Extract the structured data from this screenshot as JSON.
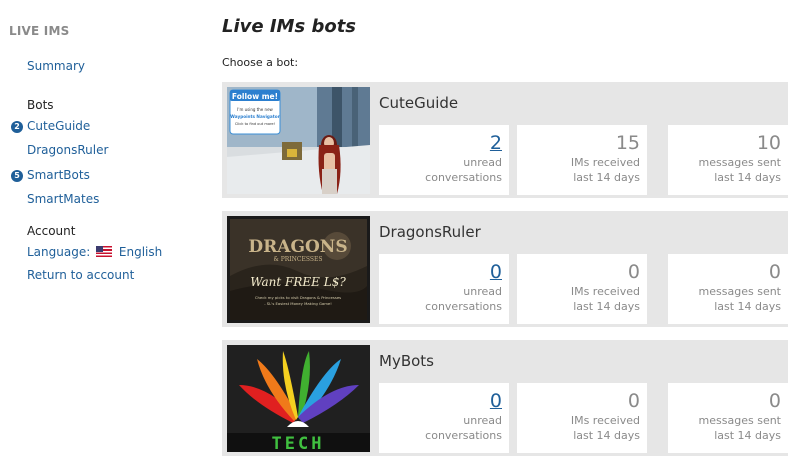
{
  "sidebar": {
    "title": "LIVE IMS",
    "summary_label": "Summary",
    "bots_heading": "Bots",
    "bots": [
      {
        "label": "CuteGuide",
        "badge": "2",
        "active": true
      },
      {
        "label": "DragonsRuler",
        "badge": "",
        "active": false
      },
      {
        "label": "SmartBots",
        "badge": "5",
        "active": true
      },
      {
        "label": "SmartMates",
        "badge": "",
        "active": false
      }
    ],
    "account_heading": "Account",
    "language_label": "Language:",
    "language_value": "English",
    "return_label": "Return to account"
  },
  "main": {
    "title": "Live IMs bots",
    "choose_label": "Choose a bot:",
    "stat_labels": {
      "unread_1": "unread",
      "unread_2": "conversations",
      "received_1": "IMs received",
      "received_2": "last 14 days",
      "sent_1": "messages sent",
      "sent_2": "last 14 days"
    },
    "bots": [
      {
        "name": "CuteGuide",
        "unread": "2",
        "received": "15",
        "sent": "10",
        "thumb_text_1": "Follow me!",
        "thumb_text_2": "I'm using the new",
        "thumb_text_3": "Waypoints Navigator",
        "thumb_text_4": "Click to find out more!"
      },
      {
        "name": "DragonsRuler",
        "unread": "0",
        "received": "0",
        "sent": "0",
        "thumb_text_1": "DRAGONS",
        "thumb_text_2": "& PRINCESSES",
        "thumb_text_3": "Want FREE L$?",
        "thumb_text_4": "Check my picks to visit Dragons & Princesses",
        "thumb_text_5": "- SL's Easiest Money Making Game!"
      },
      {
        "name": "MyBots",
        "unread": "0",
        "received": "0",
        "sent": "0",
        "thumb_text_1": "TECH"
      }
    ]
  },
  "colors": {
    "link": "#1f5f99",
    "muted": "#8a8a8a",
    "card_bg": "#e6e6e6"
  }
}
